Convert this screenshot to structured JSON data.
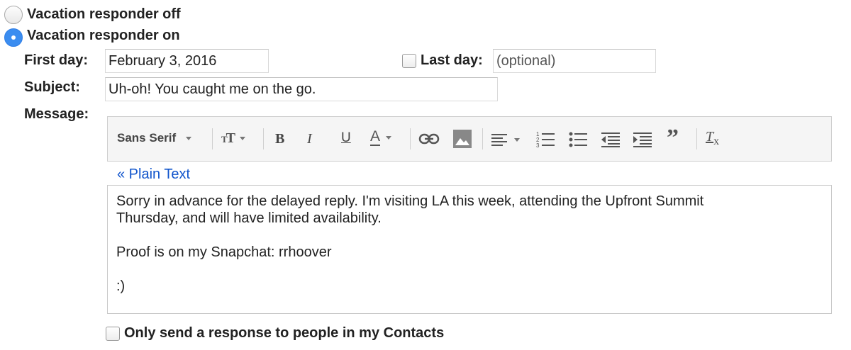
{
  "responder": {
    "off_label": "Vacation responder off",
    "on_label": "Vacation responder on",
    "selected": "on"
  },
  "first_day": {
    "label": "First day:",
    "value": "February 3, 2016"
  },
  "last_day": {
    "label": "Last day:",
    "placeholder": "(optional)",
    "checked": false
  },
  "subject": {
    "label": "Subject:",
    "value": "Uh-oh! You caught me on the go."
  },
  "message": {
    "label": "Message:",
    "toolbar": {
      "font": "Sans Serif",
      "bold": "B",
      "italic": "I",
      "underline": "U",
      "text_color": "A",
      "icons": [
        "font-size-icon",
        "link-icon",
        "image-icon",
        "align-icon",
        "numbered-list-icon",
        "bulleted-list-icon",
        "indent-less-icon",
        "indent-more-icon",
        "quote-icon",
        "remove-formatting-icon"
      ]
    },
    "plain_text_link": "« Plain Text",
    "body": [
      "Sorry in advance for the delayed reply. I'm visiting LA this week, attending the Upfront Summit",
      "Thursday, and will have limited availability.",
      "Proof is on my Snapchat: rrhoover",
      ":)"
    ]
  },
  "contacts_only": {
    "label": "Only send a response to people in my Contacts",
    "checked": false
  },
  "colors": {
    "radio_selected": "#3b8df0",
    "link": "#1155cc"
  }
}
